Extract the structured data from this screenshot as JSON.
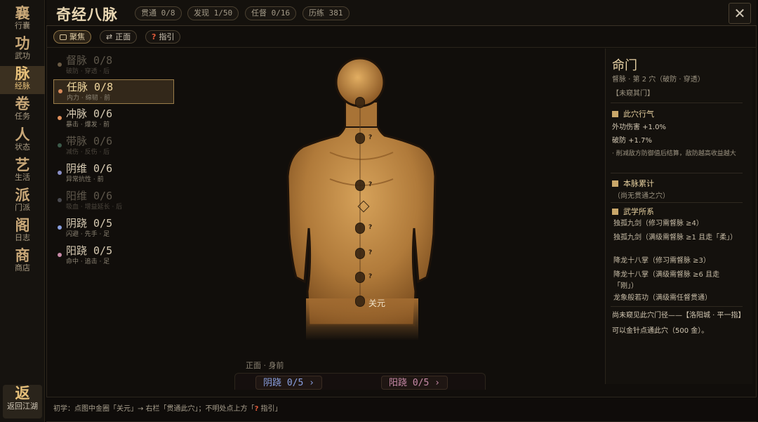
{
  "title": "奇经八脉",
  "stats": [
    "贯通 0/8",
    "发现 1/50",
    "任督 0/16",
    "历练 381"
  ],
  "close_label": "✕",
  "toolbar": {
    "focus_label": "聚焦",
    "front_label": "正面",
    "guide_label": "指引",
    "front_icon": "⇄",
    "guide_icon": "?"
  },
  "nav": [
    {
      "glyph": "襄",
      "label": "行囊"
    },
    {
      "glyph": "功",
      "label": "武功"
    },
    {
      "glyph": "脉",
      "label": "经脉"
    },
    {
      "glyph": "卷",
      "label": "任务"
    },
    {
      "glyph": "人",
      "label": "状态"
    },
    {
      "glyph": "艺",
      "label": "生活"
    },
    {
      "glyph": "派",
      "label": "门派"
    },
    {
      "glyph": "阁",
      "label": "日志"
    },
    {
      "glyph": "商",
      "label": "商店"
    }
  ],
  "nav_back": {
    "glyph": "返",
    "label": "返回江湖"
  },
  "meridians": [
    {
      "name": "督脉 0/8",
      "tags": "破防 · 穿透 · 后",
      "dot": "#6a5a44",
      "state": "dim"
    },
    {
      "name": "任脉 0/8",
      "tags": "内力 · 绵韧 · 前",
      "dot": "#d98a5a",
      "state": "sel"
    },
    {
      "name": "冲脉 0/6",
      "tags": "暴击 · 爆发 · 前",
      "dot": "#e0905c",
      "state": "lit"
    },
    {
      "name": "带脉 0/6",
      "tags": "减伤 · 反伤 · 后",
      "dot": "#3c5a4a",
      "state": "dim"
    },
    {
      "name": "阴维 0/6",
      "tags": "异常抗性 · 前",
      "dot": "#8a8fc8",
      "state": "lit"
    },
    {
      "name": "阳维 0/6",
      "tags": "吸血 · 增益延长 · 后",
      "dot": "#4a4a50",
      "state": "dim"
    },
    {
      "name": "阴跷 0/5",
      "tags": "闪避 · 先手 · 足",
      "dot": "#8aa0e0",
      "state": "lit"
    },
    {
      "name": "阳跷 0/5",
      "tags": "命中 · 追击 · 足",
      "dot": "#c88aa8",
      "state": "lit"
    }
  ],
  "figure": {
    "acupoint_label": "关元",
    "view_label": "正面 · 身前",
    "left_link": "阴跷 0/5 ›",
    "right_link": "阳跷 0/5 ›",
    "left_color": "#8aa0e0",
    "right_color": "#c88aa8"
  },
  "info": {
    "title": "命门",
    "subtitle": "督脉 · 第 2 穴（破防 · 穿透）",
    "status": "【未窥其门】",
    "section1": "此穴行气",
    "effect1": "外功伤害 +1.0%",
    "effect2": "破防 +1.7%",
    "note": "· 削减敌方防御值后结算，敌防越高收益越大",
    "section2": "本脉累计",
    "accum": "（尚无贯通之穴）",
    "section3": "武学所系",
    "skills": [
      "独孤九剑（修习需督脉 ≥4）",
      "独孤九剑（满级需督脉 ≥1 且走「柔」）",
      "降龙十八掌（修习需督脉 ≥3）",
      "降龙十八掌（满级需督脉 ≥6 且走「刚」）",
      "龙象般若功（满级需任督贯通）"
    ],
    "hint": "尚未窥见此穴门径——【洛阳城 · 平一指】可以金针点通此穴（500 金）。"
  },
  "footer": {
    "text_before": "初学：点图中金圈「关元」→ 右栏「贯通此穴」；不明处点上方「",
    "q": "?",
    "text_after": " 指引」"
  }
}
